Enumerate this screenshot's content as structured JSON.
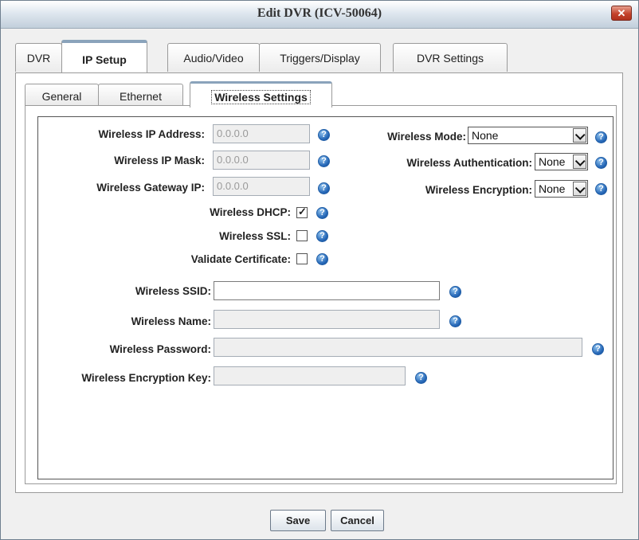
{
  "window": {
    "title": "Edit DVR (ICV-50064)",
    "close_glyph": "✕"
  },
  "main_tabs": [
    "DVR",
    "IP Setup",
    "Audio/Video",
    "Triggers/Display",
    "DVR Settings"
  ],
  "sub_tabs": [
    "General",
    "Ethernet",
    "Wireless Settings"
  ],
  "form": {
    "ip_address_label": "Wireless IP Address:",
    "ip_address_value": "0.0.0.0",
    "ip_mask_label": "Wireless IP Mask:",
    "ip_mask_value": "0.0.0.0",
    "gateway_label": "Wireless Gateway IP:",
    "gateway_value": "0.0.0.0",
    "dhcp_label": "Wireless DHCP:",
    "dhcp_checked": true,
    "ssl_label": "Wireless SSL:",
    "ssl_checked": false,
    "validate_label": "Validate Certificate:",
    "validate_checked": false,
    "ssid_label": "Wireless SSID:",
    "ssid_value": "",
    "name_label": "Wireless Name:",
    "name_value": "",
    "password_label": "Wireless Password:",
    "password_value": "",
    "enc_key_label": "Wireless Encryption Key:",
    "enc_key_value": "",
    "mode_label": "Wireless Mode:",
    "mode_value": "None",
    "auth_label": "Wireless Authentication:",
    "auth_value": "None",
    "encryption_label": "Wireless Encryption:",
    "encryption_value": "None"
  },
  "buttons": {
    "save": "Save",
    "cancel": "Cancel"
  },
  "icons": {
    "help": "help-icon",
    "help_glyph": "?"
  },
  "colors": {
    "accent_tab_border": "#8aa3bb",
    "help_blue": "#2567b7",
    "close_red": "#c4422b"
  }
}
